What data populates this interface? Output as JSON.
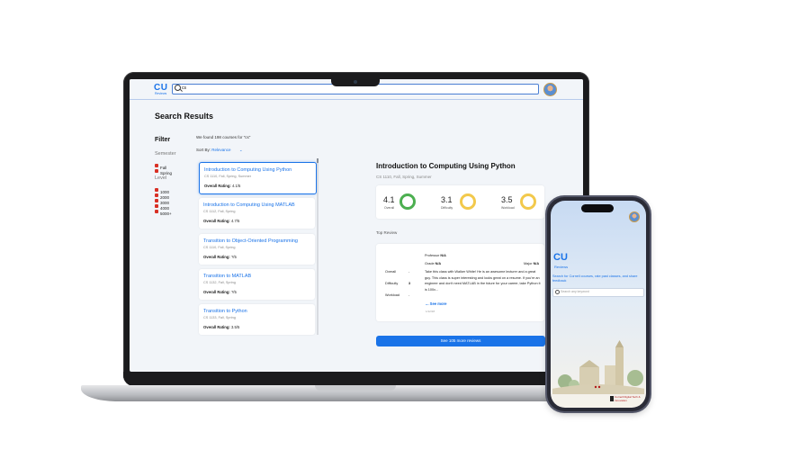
{
  "app": {
    "logo": "CU",
    "logo_sub": "Reviews",
    "search_value": "cs",
    "page_title": "Search Results"
  },
  "filter": {
    "title": "Filter",
    "semester_label": "Semester",
    "semesters": [
      "Fall",
      "Spring"
    ],
    "level_label": "Level",
    "levels": [
      "1000",
      "2000",
      "3000",
      "4000",
      "5000+"
    ]
  },
  "results": {
    "found_text": "We found 198 courses for \"cs\"",
    "sort_label": "Sort By:",
    "sort_value": "Relevance",
    "courses": [
      {
        "title": "Introduction to Computing Using Python",
        "sub": "CS 1110, Fall, Spring, Summer",
        "rating_label": "Overall Rating:",
        "rating": "4.1/5"
      },
      {
        "title": "Introduction to Computing Using MATLAB",
        "sub": "CS 1112, Fall, Spring",
        "rating_label": "Overall Rating:",
        "rating": "4.7/5"
      },
      {
        "title": "Transition to Object-Oriented Programming",
        "sub": "CS 1110, Fall, Spring",
        "rating_label": "Overall Rating:",
        "rating": "?/5"
      },
      {
        "title": "Transition to MATLAB",
        "sub": "CS 1132, Fall, Spring",
        "rating_label": "Overall Rating:",
        "rating": "?/5"
      },
      {
        "title": "Transition to Python",
        "sub": "CS 1133, Fall, Spring",
        "rating_label": "Overall Rating:",
        "rating": "3.5/5"
      }
    ]
  },
  "detail": {
    "title": "Introduction to Computing Using Python",
    "sub": "CS 1110, Fall, Spring, Summer",
    "metrics": [
      {
        "value": "4.1",
        "label": "Overall",
        "color": "#4caf50"
      },
      {
        "value": "3.1",
        "label": "Difficulty",
        "color": "#f2c94c"
      },
      {
        "value": "3.5",
        "label": "Workload",
        "color": "#f2c94c"
      }
    ],
    "top_review_label": "Top Review",
    "review": {
      "professor_label": "Professor",
      "professor": "N/A",
      "grade_label": "Grade",
      "grade": "N/A",
      "major_label": "Major",
      "major": "N/A",
      "overall_label": "Overall",
      "overall": "-",
      "difficulty_label": "Difficulty",
      "difficulty": "3",
      "workload_label": "Workload",
      "workload": "-",
      "text": "Take this class with Walker White! He is an awesome lecturer and a great guy. This class is super interesting and looks great on a resume. If you're an engineer and don't need MATLAB in the future for your career, take Python it is 100x...",
      "see_more": "... See more",
      "date": "1/12/18"
    },
    "see_more_button": "See 105 more reviews"
  },
  "phone": {
    "logo": "CU",
    "logo_sub": "Reviews",
    "description": "Search for Cornell courses, rate past classes, and share feedback",
    "search_placeholder": "Search any keyword",
    "badge": "Cornell Digital Tech & Innovation"
  }
}
